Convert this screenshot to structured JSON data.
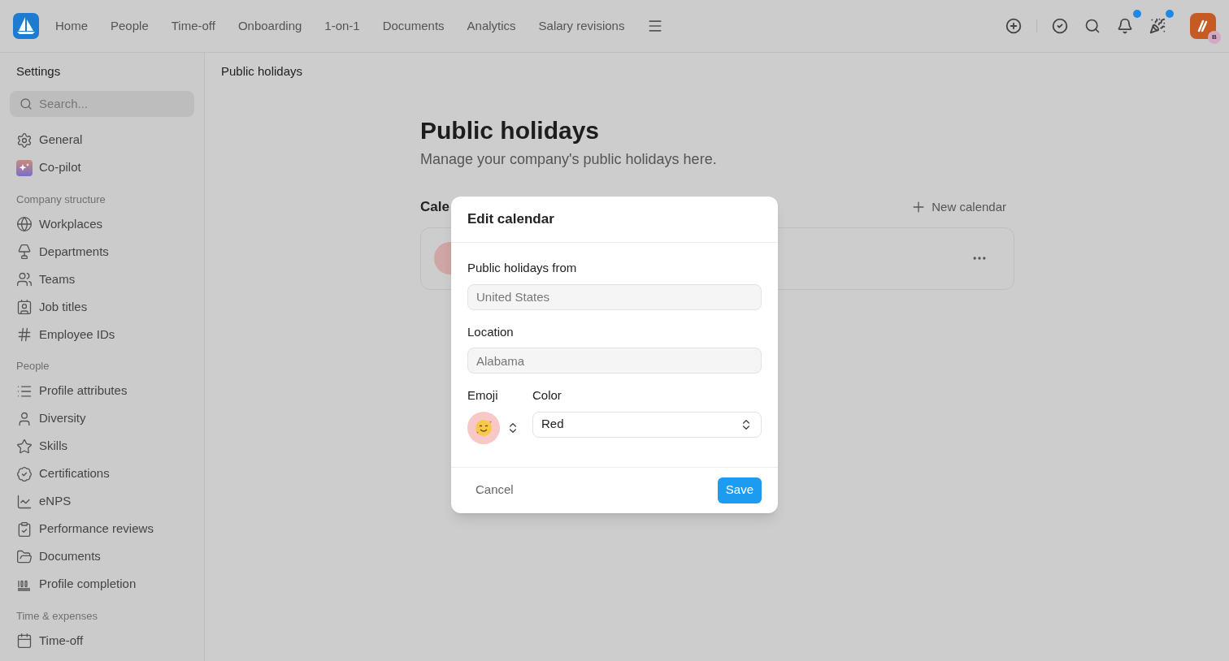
{
  "topbar": {
    "nav": [
      {
        "label": "Home"
      },
      {
        "label": "People"
      },
      {
        "label": "Time-off"
      },
      {
        "label": "Onboarding"
      },
      {
        "label": "1-on-1"
      },
      {
        "label": "Documents"
      },
      {
        "label": "Analytics"
      },
      {
        "label": "Salary revisions"
      }
    ],
    "actions": [
      {
        "kind": "add",
        "dot": false
      },
      {
        "kind": "tasks",
        "dot": false
      },
      {
        "kind": "search",
        "dot": false
      },
      {
        "kind": "notifications",
        "dot": true
      },
      {
        "kind": "celebrations",
        "dot": true
      }
    ],
    "avatar_badge": "B"
  },
  "sidebar": {
    "title": "Settings",
    "search": {
      "placeholder": "Search..."
    },
    "sections": [
      {
        "items": [
          {
            "label": "General"
          },
          {
            "label": "Co-pilot"
          }
        ]
      },
      {
        "heading": "Company structure",
        "items": [
          {
            "label": "Workplaces"
          },
          {
            "label": "Departments"
          },
          {
            "label": "Teams"
          },
          {
            "label": "Job titles"
          },
          {
            "label": "Employee IDs"
          }
        ]
      },
      {
        "heading": "People",
        "items": [
          {
            "label": "Profile attributes"
          },
          {
            "label": "Diversity"
          },
          {
            "label": "Skills"
          },
          {
            "label": "Certifications"
          },
          {
            "label": "eNPS"
          },
          {
            "label": "Performance reviews"
          },
          {
            "label": "Documents"
          },
          {
            "label": "Profile completion"
          }
        ]
      },
      {
        "heading": "Time & expenses",
        "items": [
          {
            "label": "Time-off"
          }
        ]
      }
    ]
  },
  "breadcrumb": "Public holidays",
  "page": {
    "title": "Public holidays",
    "subtitle": "Manage your company's public holidays here.",
    "section_heading": "Cale",
    "new_button": "New calendar"
  },
  "dialog": {
    "title": "Edit calendar",
    "fields": [
      {
        "label": "Public holidays from",
        "value": "United States",
        "disabled": true
      },
      {
        "label": "Location",
        "value": "Alabama",
        "disabled": true
      }
    ],
    "emoji_label": "Emoji",
    "color_label": "Color",
    "color_value": "Red",
    "color": "#f8c8c8",
    "cancel": "Cancel",
    "save": "Save"
  }
}
